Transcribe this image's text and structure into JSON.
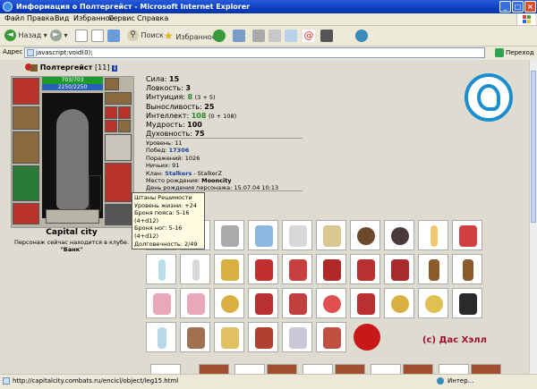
{
  "window": {
    "title": "Информация о Полтергейст - Microsoft Internet Explorer",
    "buttons": [
      "_",
      "□",
      "×"
    ]
  },
  "menu": [
    "Файл",
    "Правка",
    "Вид",
    "Избранное",
    "Сервис",
    "Справка"
  ],
  "toolbar": {
    "back": "Назад",
    "search": "Поиск",
    "favorites": "Избранное"
  },
  "address": {
    "label": "Адрес",
    "url": "javascript:void(0);",
    "go": "Переход"
  },
  "status": {
    "url": "http://capitalcity.combats.ru/encicl/object/leg15.html",
    "zone": "Интер..."
  },
  "character": {
    "name": "Полтергейст",
    "level": "[11]",
    "hp": "703/703",
    "mp": "2250/2250",
    "city": "Capital city",
    "location_line": "Персонаж сейчас находится в клубе.",
    "location_place": "\"Банк\""
  },
  "stats": [
    {
      "label": "Сила:",
      "value": "15",
      "extra": ""
    },
    {
      "label": "Ловкость:",
      "value": "3",
      "extra": ""
    },
    {
      "label": "Интуиция:",
      "value": "8",
      "extra": "(3 + 5)",
      "color": "#2a8a2a"
    },
    {
      "label": "Выносливость:",
      "value": "25",
      "extra": ""
    },
    {
      "label": "Интеллект:",
      "value": "108",
      "extra": "(0 + 108)",
      "color": "#2a8a2a"
    },
    {
      "label": "Мудрость:",
      "value": "100",
      "extra": ""
    },
    {
      "label": "Духовность:",
      "value": "75",
      "extra": ""
    }
  ],
  "details": {
    "level": "Уровень: 11",
    "wins_label": "Побед:",
    "wins": "17306",
    "losses": "Поражений: 1026",
    "draws": "Ничьих: 91",
    "clan_label": "Клан:",
    "clan": "Stalkers",
    "clan_rank": " - StalkerZ",
    "birthplace_label": "Место рождения:",
    "birthplace": "Mooncity",
    "birthday": "День рождения персонажа: 15.07.04 10:13"
  },
  "tooltip": [
    "Штаны Решимости",
    "Уровень жизни: +24",
    "Броня пояса: 5-16 (4+d12)",
    "Броня ног: 5-16 (4+d12)",
    "Долговечность: 2/49"
  ],
  "copyright": "(c) Дас Хэлл",
  "colors": {
    "accent": "#1b8ed0",
    "copyright": "#a0102a",
    "titlebar": "#0a3fc0"
  }
}
